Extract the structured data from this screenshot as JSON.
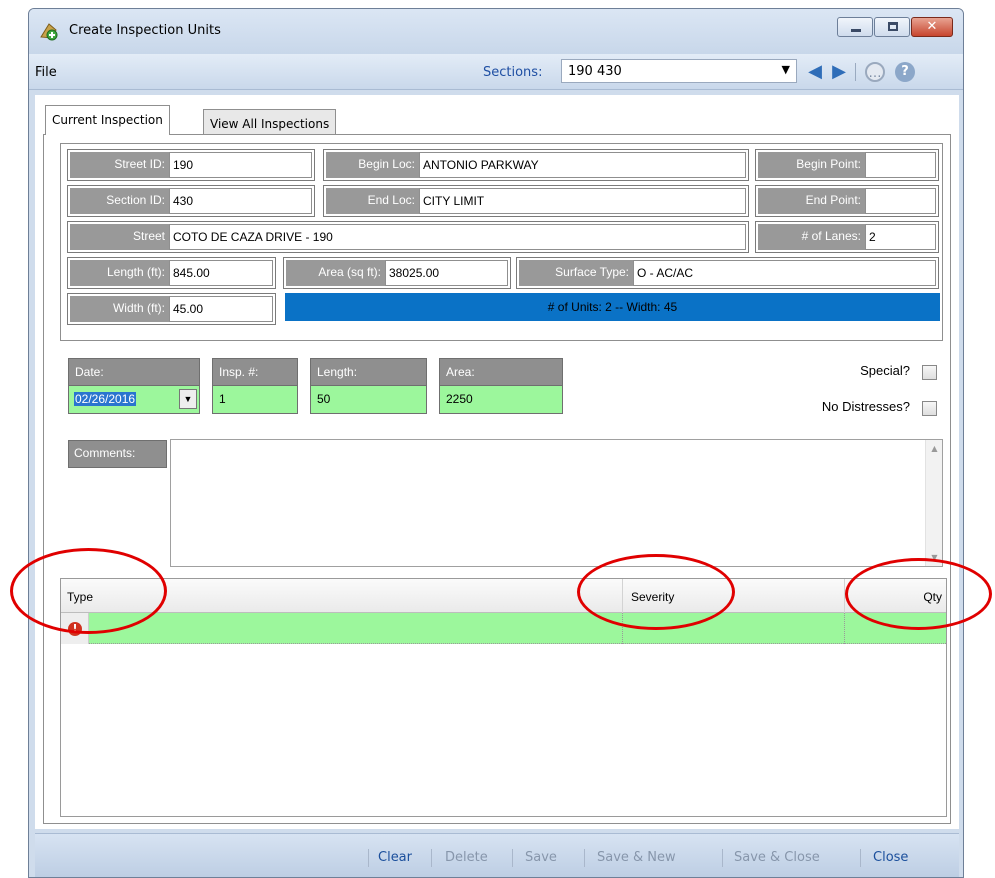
{
  "window": {
    "title": "Create Inspection Units"
  },
  "menu": {
    "file": "File",
    "sections_label": "Sections:",
    "sections_value": "190 430"
  },
  "tabs": [
    {
      "label": "Current Inspection",
      "active": true
    },
    {
      "label": "View All Inspections",
      "active": false
    }
  ],
  "section_info": {
    "street_id_label": "Street ID:",
    "street_id": "190",
    "begin_loc_label": "Begin Loc:",
    "begin_loc": "ANTONIO PARKWAY",
    "begin_point_label": "Begin Point:",
    "begin_point": "",
    "section_id_label": "Section ID:",
    "section_id": "430",
    "end_loc_label": "End Loc:",
    "end_loc": "CITY LIMIT",
    "end_point_label": "End Point:",
    "end_point": "",
    "street_label": "Street",
    "street": "COTO DE CAZA DRIVE - 190",
    "lanes_label": "# of Lanes:",
    "lanes": "2",
    "length_label": "Length (ft):",
    "length": "845.00",
    "area_label": "Area (sq ft):",
    "area": "38025.00",
    "surface_label": "Surface Type:",
    "surface": "O - AC/AC",
    "width_label": "Width (ft):",
    "width": "45.00",
    "units_summary": "# of Units: 2 -- Width: 45"
  },
  "inspection": {
    "date_label": "Date:",
    "date": "02/26/2016",
    "insp_label": "Insp. #:",
    "insp": "1",
    "length_label": "Length:",
    "length": "50",
    "area_label": "Area:",
    "area": "2250",
    "special_label": "Special?",
    "special_checked": false,
    "no_distress_label": "No Distresses?",
    "no_distress_checked": false,
    "comments_label": "Comments:",
    "comments": ""
  },
  "grid": {
    "columns": [
      "Type",
      "Severity",
      "Qty"
    ],
    "rows": [
      {
        "type": "",
        "severity": "",
        "qty": "",
        "status_icon": "error-icon"
      }
    ]
  },
  "actions": {
    "clear": "Clear",
    "delete": "Delete",
    "save": "Save",
    "save_new": "Save & New",
    "save_close": "Save & Close",
    "close": "Close"
  },
  "colors": {
    "label_bg": "#999999",
    "row_green": "#9cf79c",
    "units_bar": "#0a72c6",
    "annotation_red": "#e00000"
  }
}
